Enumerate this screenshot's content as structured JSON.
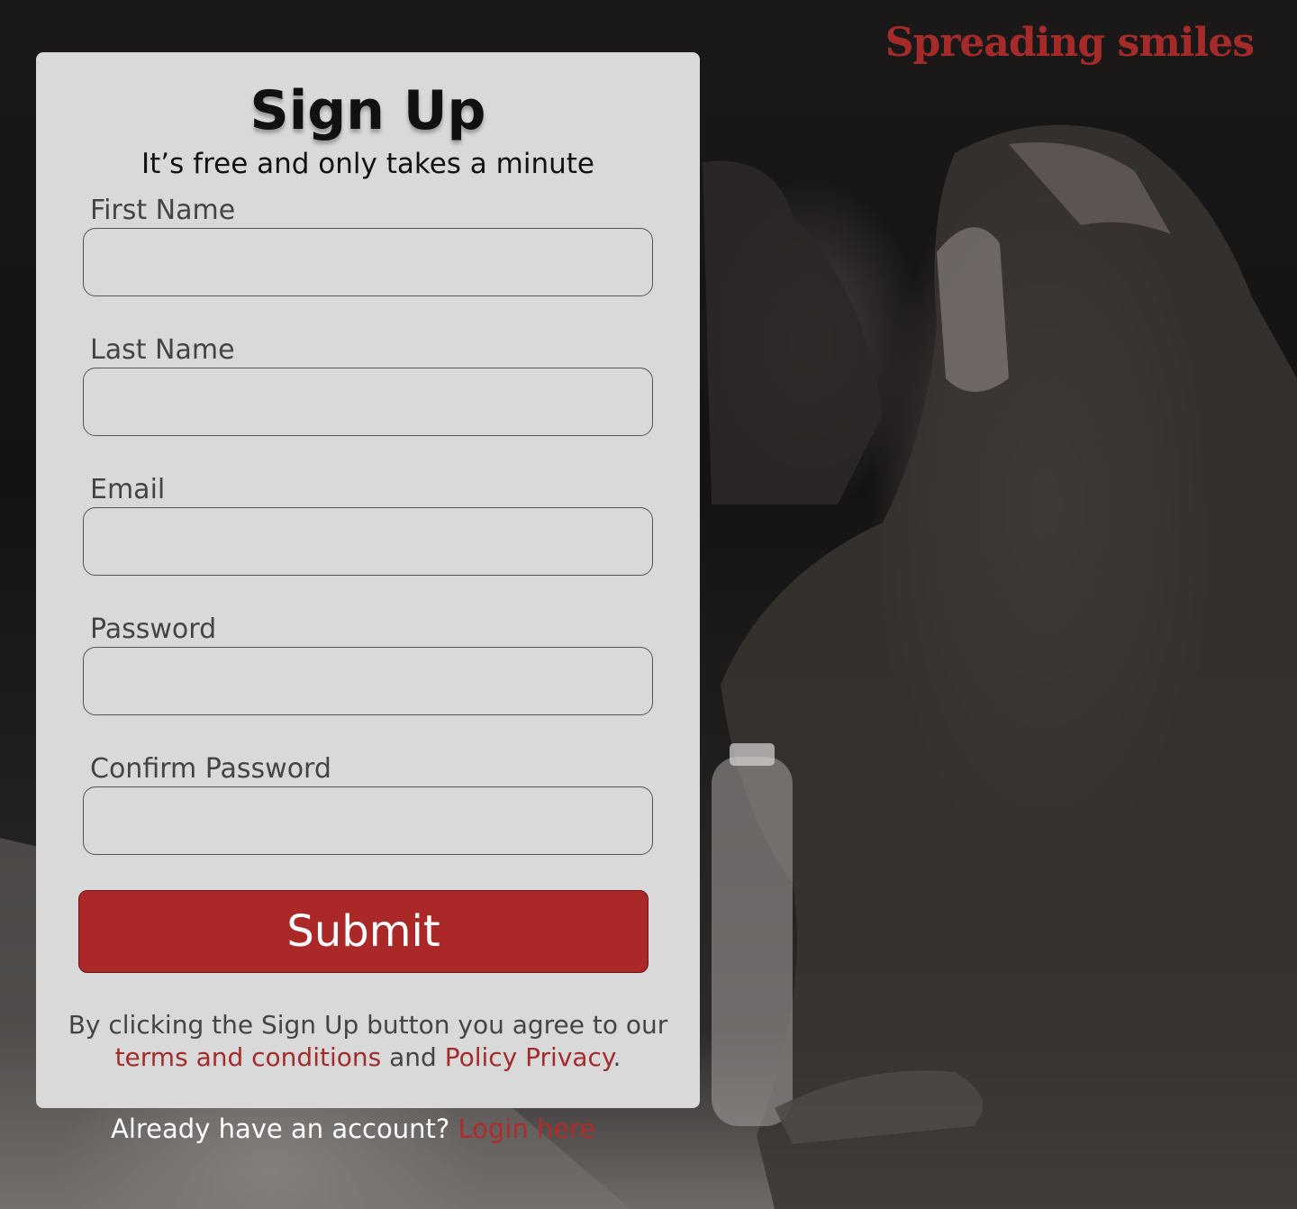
{
  "brand": {
    "name": "Spreading smiles"
  },
  "form": {
    "title": "Sign Up",
    "subtitle": "It’s free and only takes a minute",
    "fields": [
      {
        "label": "First Name",
        "value": "",
        "placeholder": ""
      },
      {
        "label": "Last Name",
        "value": "",
        "placeholder": ""
      },
      {
        "label": "Email",
        "value": "",
        "placeholder": ""
      },
      {
        "label": "Password",
        "value": "",
        "placeholder": ""
      },
      {
        "label": "Confirm Password",
        "value": "",
        "placeholder": ""
      }
    ],
    "submit_label": "Submit",
    "terms": {
      "prefix": "By clicking the Sign Up button you agree to our ",
      "terms_link": "terms and conditions",
      "middle": " and ",
      "privacy_link": "Policy Privacy",
      "suffix": "."
    }
  },
  "login": {
    "prompt": "Already have an account? ",
    "link": "Login here"
  },
  "colors": {
    "accent": "#ab2829",
    "card_bg": "#d9d9d9",
    "brand": "#a52b2b"
  }
}
